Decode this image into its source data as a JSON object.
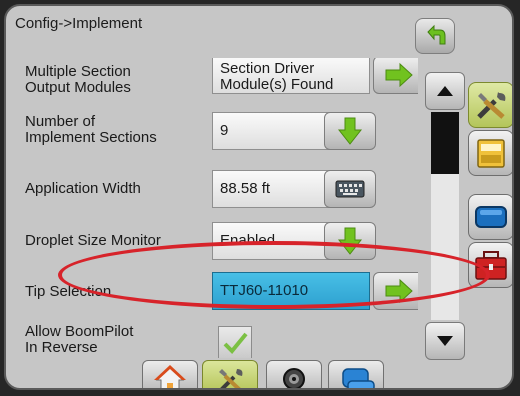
{
  "header": {
    "title": "Config->Implement"
  },
  "rows": [
    {
      "label": "Multiple Section\nOutput Modules",
      "value": "Section Driver\nModule(s) Found",
      "action": "arrow-right-icon"
    },
    {
      "label": "Number of\nImplement Sections",
      "value": "9",
      "action": "arrow-down-icon"
    },
    {
      "label": "Application Width",
      "value": "88.58 ft",
      "action": "keyboard-icon"
    },
    {
      "label": "Droplet Size Monitor",
      "value": "Enabled",
      "action": "arrow-down-icon"
    },
    {
      "label": "Tip Selection",
      "value": "TTJ60-11010",
      "action": "arrow-right-icon",
      "selected": true
    },
    {
      "label": "Allow BoomPilot\nIn Reverse",
      "checked": true
    }
  ],
  "icons": {
    "back": "back-arrow-icon",
    "side": [
      "tools-icon",
      "console-icon",
      "display-icon",
      "toolbox-icon"
    ],
    "bottom": [
      "home-icon",
      "tools-icon",
      "camera-icon",
      "guidance-icon"
    ]
  },
  "colors": {
    "selected": "#3bb2df",
    "arrow": "#71c21f",
    "highlight_ring": "#d7232a",
    "active_tab": "#c6d16f"
  }
}
